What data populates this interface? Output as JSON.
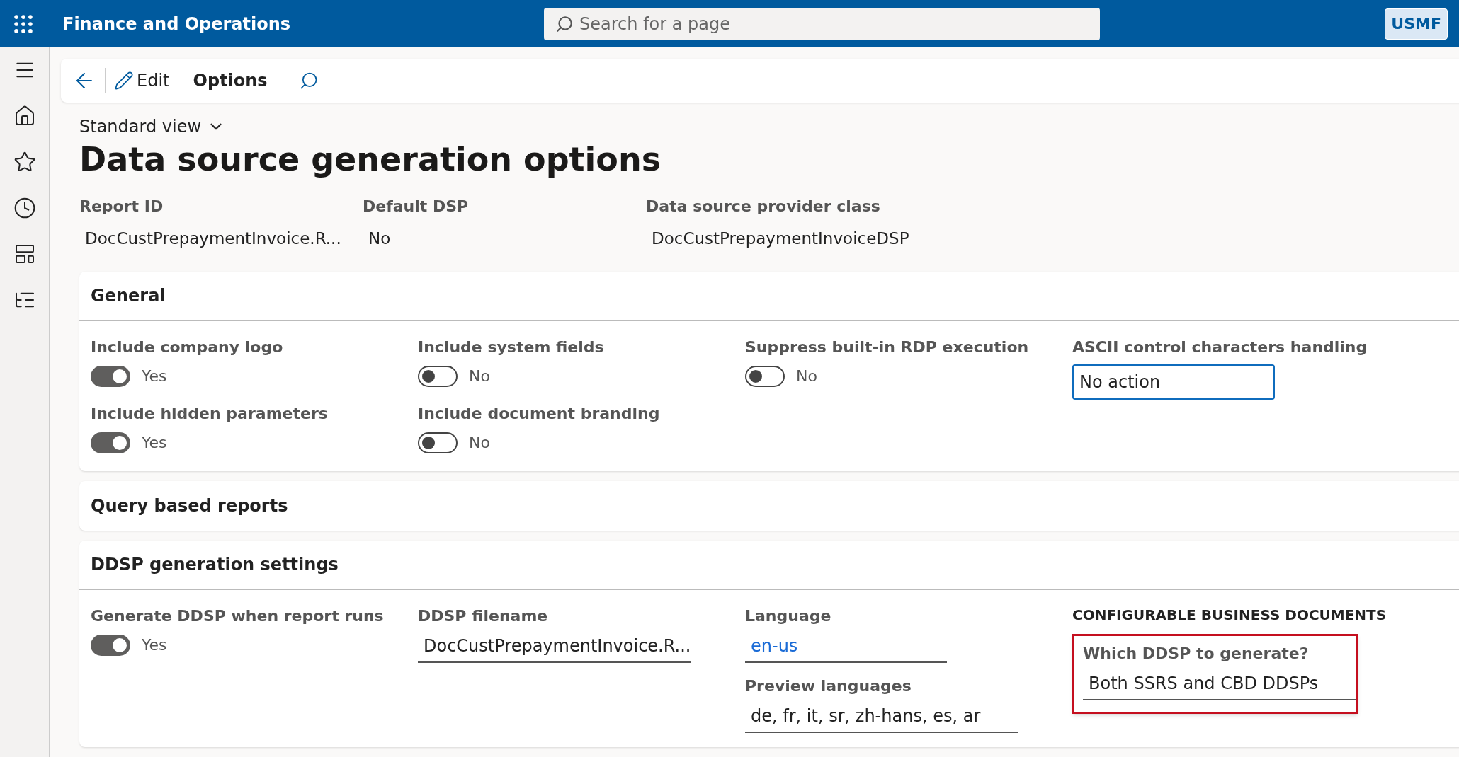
{
  "topbar": {
    "app_title": "Finance and Operations",
    "search": {
      "placeholder": "Search for a page"
    },
    "company": "USMF"
  },
  "toolbar": {
    "edit_label": "Edit",
    "options_label": "Options"
  },
  "view_selector": "Standard view",
  "page_title": "Data source generation options",
  "header_fields": [
    {
      "label": "Report ID",
      "value": "DocCustPrepaymentInvoice.R..."
    },
    {
      "label": "Default DSP",
      "value": "No"
    },
    {
      "label": "Data source provider class",
      "value": "DocCustPrepaymentInvoiceDSP"
    }
  ],
  "sections": [
    {
      "title": "General",
      "expanded": true,
      "columns": [
        [
          {
            "kind": "toggle",
            "label": "Include company logo",
            "on": true,
            "value_text": "Yes"
          },
          {
            "kind": "toggle",
            "label": "Include hidden parameters",
            "on": true,
            "value_text": "Yes"
          }
        ],
        [
          {
            "kind": "toggle",
            "label": "Include system fields",
            "on": false,
            "value_text": "No"
          },
          {
            "kind": "toggle",
            "label": "Include document branding",
            "on": false,
            "value_text": "No"
          }
        ],
        [
          {
            "kind": "toggle",
            "label": "Suppress built-in RDP execution",
            "on": false,
            "value_text": "No"
          }
        ],
        [
          {
            "kind": "select",
            "label": "ASCII control characters handling",
            "value": "No action"
          }
        ]
      ]
    },
    {
      "title": "Query based reports",
      "expanded": false
    },
    {
      "title": "DDSP generation settings",
      "expanded": true,
      "columns": [
        [
          {
            "kind": "toggle",
            "label": "Generate DDSP when report runs",
            "on": true,
            "value_text": "Yes"
          }
        ],
        [
          {
            "kind": "text",
            "label": "DDSP filename",
            "value": "DocCustPrepaymentInvoice.R..."
          }
        ],
        [
          {
            "kind": "link",
            "label": "Language",
            "value": "en-us"
          },
          {
            "kind": "text",
            "label": "Preview languages",
            "value": "de, fr, it, sr, zh-hans, es, ar"
          }
        ],
        [
          {
            "kind": "group",
            "heading": "CONFIGURABLE BUSINESS DOCUMENTS",
            "fields": [
              {
                "kind": "text",
                "label": "Which DDSP to generate?",
                "value": "Both SSRS and CBD DDSPs",
                "highlighted": true
              }
            ]
          }
        ]
      ]
    }
  ]
}
